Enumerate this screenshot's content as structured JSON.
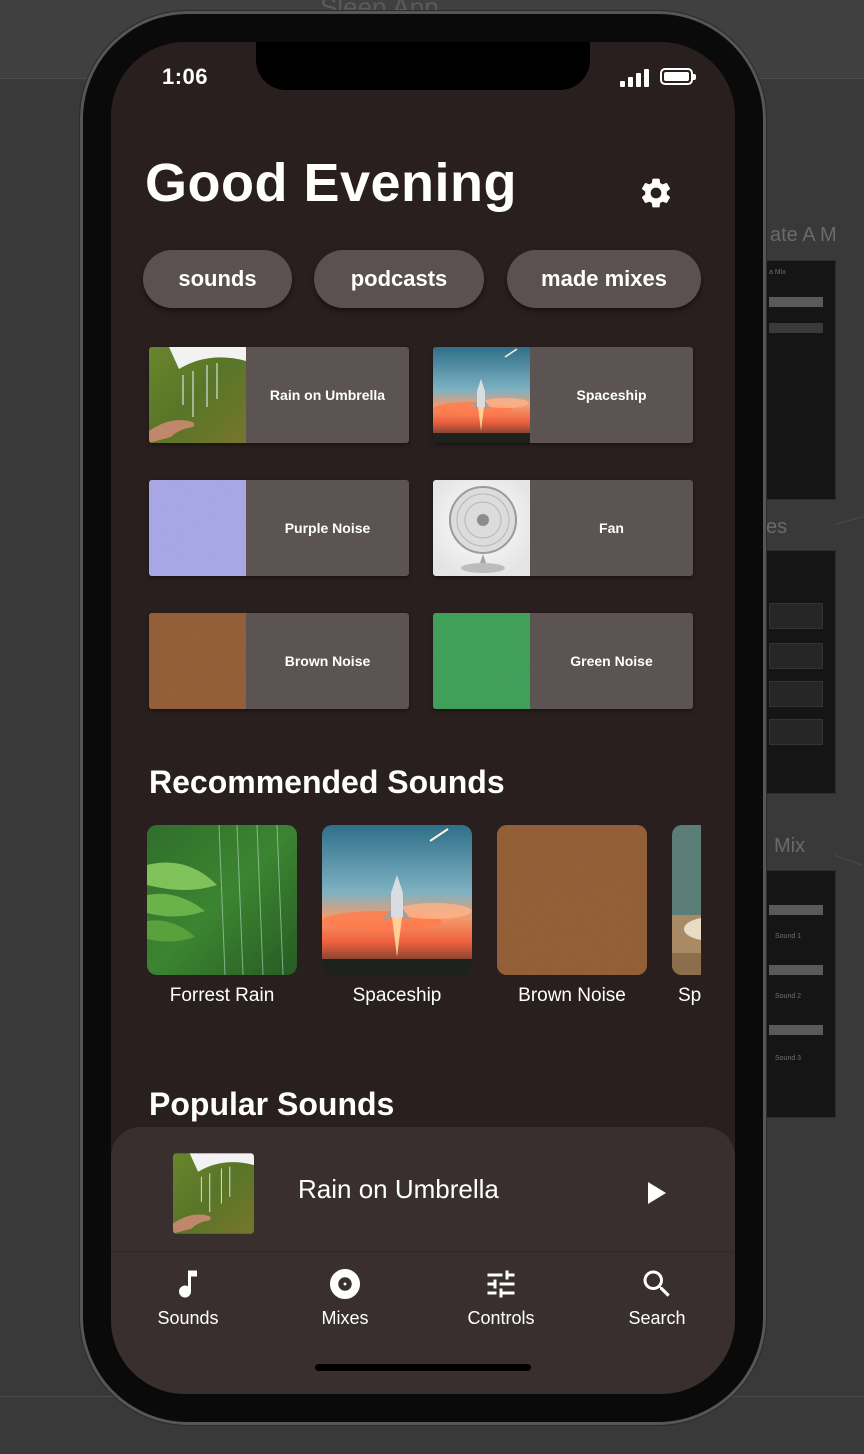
{
  "background": {
    "title": "Sleep App",
    "labels": [
      "ate A M",
      "es",
      "Mix"
    ],
    "mini_tiny": [
      "a Mix",
      "Sound 1",
      "Sound 2",
      "Sound 3"
    ]
  },
  "status": {
    "time": "1:06"
  },
  "header": {
    "greeting": "Good Evening"
  },
  "chips": [
    "sounds",
    "podcasts",
    "made mixes"
  ],
  "grid": [
    {
      "label": "Rain on Umbrella",
      "thumb": "rain-umbrella"
    },
    {
      "label": "Spaceship",
      "thumb": "spaceship"
    },
    {
      "label": "Purple Noise",
      "thumb": "purple-noise"
    },
    {
      "label": "Fan",
      "thumb": "fan"
    },
    {
      "label": "Brown Noise",
      "thumb": "brown-noise"
    },
    {
      "label": "Green Noise",
      "thumb": "green-noise"
    }
  ],
  "recommended": {
    "title": "Recommended Sounds",
    "items": [
      {
        "label": "Forrest Rain",
        "thumb": "forest-rain"
      },
      {
        "label": "Spaceship",
        "thumb": "spaceship"
      },
      {
        "label": "Brown Noise",
        "thumb": "brown-noise"
      },
      {
        "label": "Sp",
        "thumb": "cabin"
      }
    ]
  },
  "popular": {
    "title": "Popular Sounds"
  },
  "player": {
    "title": "Rain on Umbrella"
  },
  "tabs": [
    {
      "label": "Sounds",
      "icon": "music-note-icon"
    },
    {
      "label": "Mixes",
      "icon": "disc-icon"
    },
    {
      "label": "Controls",
      "icon": "tune-sliders-icon"
    },
    {
      "label": "Search",
      "icon": "search-icon"
    }
  ],
  "colors": {
    "screen_bg": "#2a1f1f",
    "card_bg": "#5c5353",
    "chip_bg": "#5b5151",
    "bar_bg": "#3a2f2f",
    "text": "#ffffff"
  }
}
